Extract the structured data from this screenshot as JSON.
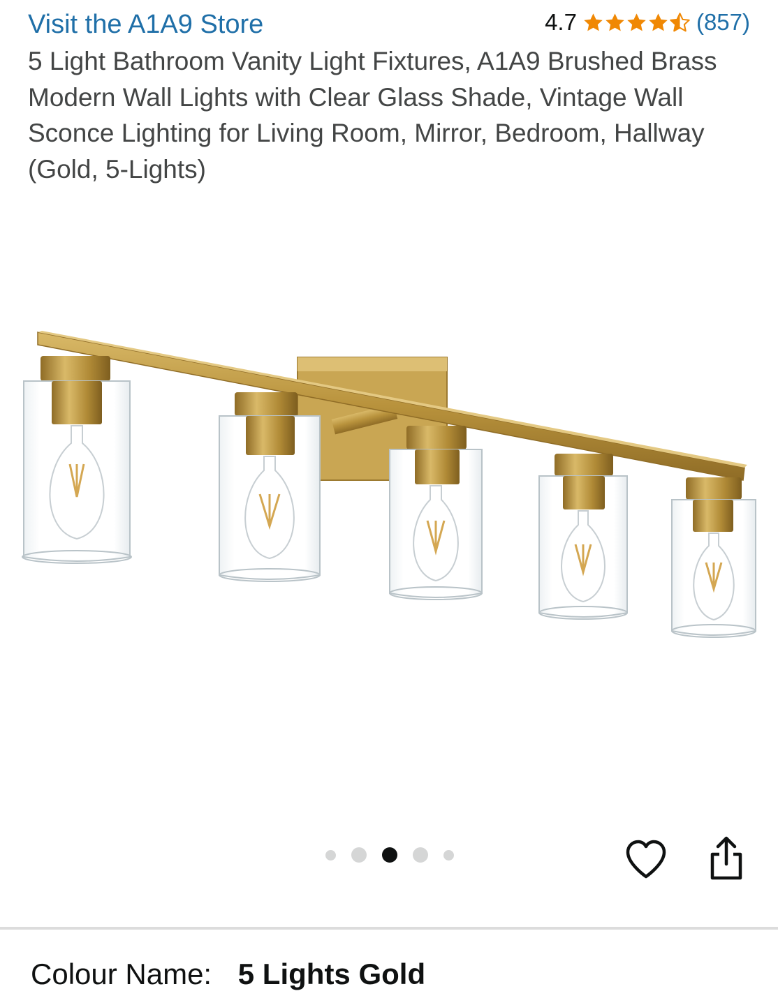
{
  "store": {
    "link_text": "Visit the A1A9 Store"
  },
  "rating": {
    "value": "4.7",
    "stars": 4.5,
    "review_count": "(857)",
    "star_color": "#f08804"
  },
  "product": {
    "title": "5 Light Bathroom Vanity Light Fixtures, A1A9 Brushed Brass Modern Wall Lights with Clear Glass Shade, Vintage Wall Sconce Lighting for Living Room, Mirror, Bedroom, Hallway (Gold, 5-Lights)"
  },
  "gallery": {
    "image_count": 5,
    "active_index": 2
  },
  "actions": {
    "wishlist_icon": "heart-icon",
    "share_icon": "share-icon"
  },
  "variation": {
    "label": "Colour Name:",
    "value": "5 Lights Gold"
  },
  "colors": {
    "link": "#1f6fa8",
    "text": "#0f1111",
    "brass": "#b8923c",
    "divider": "#dcdcdc"
  }
}
